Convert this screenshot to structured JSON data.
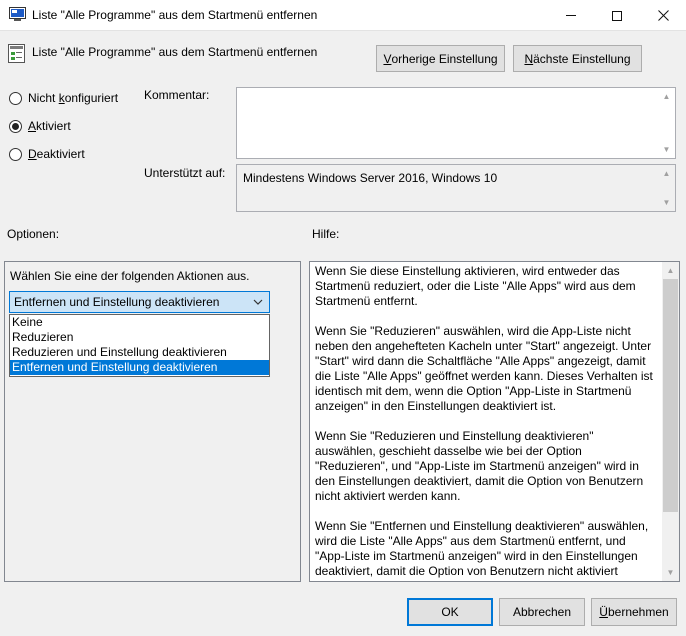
{
  "window": {
    "title": "Liste \"Alle Programme\" aus dem Startmenü entfernen",
    "controls": [
      "minimize-icon",
      "maximize-icon",
      "close-icon"
    ]
  },
  "header": {
    "policy_title": "Liste \"Alle Programme\" aus dem Startmenü entfernen",
    "prev_label_ul": "V",
    "prev_label_rest": "orherige Einstellung",
    "next_label_ul": "N",
    "next_label_rest": "ächste Einstellung"
  },
  "state": {
    "options": [
      {
        "pre": "Nicht ",
        "ul": "k",
        "post": "onfiguriert",
        "checked": false
      },
      {
        "pre": "",
        "ul": "A",
        "post": "ktiviert",
        "checked": true
      },
      {
        "pre": "",
        "ul": "D",
        "post": "eaktiviert",
        "checked": false
      }
    ]
  },
  "comment": {
    "label": "Kommentar:",
    "value": ""
  },
  "supported": {
    "label": "Unterstützt auf:",
    "value": "Mindestens Windows Server 2016, Windows 10"
  },
  "options_section": {
    "label": "Optionen:",
    "prompt": "Wählen Sie eine der folgenden Aktionen aus.",
    "selected": "Entfernen und Einstellung deaktivieren",
    "items": [
      "Keine",
      "Reduzieren",
      "Reduzieren und Einstellung deaktivieren",
      "Entfernen und Einstellung deaktivieren"
    ],
    "highlighted_index": 3
  },
  "help_section": {
    "label": "Hilfe:",
    "paragraphs": [
      "Wenn Sie diese Einstellung aktivieren, wird entweder das Startmenü reduziert, oder die Liste \"Alle Apps\" wird aus dem Startmenü entfernt.",
      "Wenn Sie \"Reduzieren\" auswählen, wird die App-Liste nicht neben den angehefteten Kacheln unter \"Start\" angezeigt. Unter \"Start\" wird dann die Schaltfläche \"Alle Apps\" angezeigt, damit die Liste \"Alle Apps\" geöffnet werden kann. Dieses Verhalten ist identisch mit dem, wenn die Option \"App-Liste in Startmenü anzeigen\" in den Einstellungen deaktiviert ist.",
      "Wenn Sie \"Reduzieren und Einstellung deaktivieren\" auswählen, geschieht dasselbe wie bei der Option \"Reduzieren\", und \"App-Liste im Startmenü anzeigen\" wird in den Einstellungen deaktiviert, damit die Option von Benutzern nicht aktiviert werden kann.",
      "Wenn Sie \"Entfernen und Einstellung deaktivieren\" auswählen, wird die Liste \"Alle Apps\" aus dem Startmenü entfernt, und \"App-Liste im Startmenü anzeigen\" wird in den Einstellungen deaktiviert, damit die Option von Benutzern nicht aktiviert werden kann. Wählen Sie diese Option, um die Liste \"Alle Apps\" vollständig zu entfernen."
    ]
  },
  "footer": {
    "ok": "OK",
    "cancel": "Abbrechen",
    "apply_ul": "Ü",
    "apply_rest": "bernehmen"
  },
  "colors": {
    "accent": "#0078d7",
    "selection": "#cce4f7"
  }
}
